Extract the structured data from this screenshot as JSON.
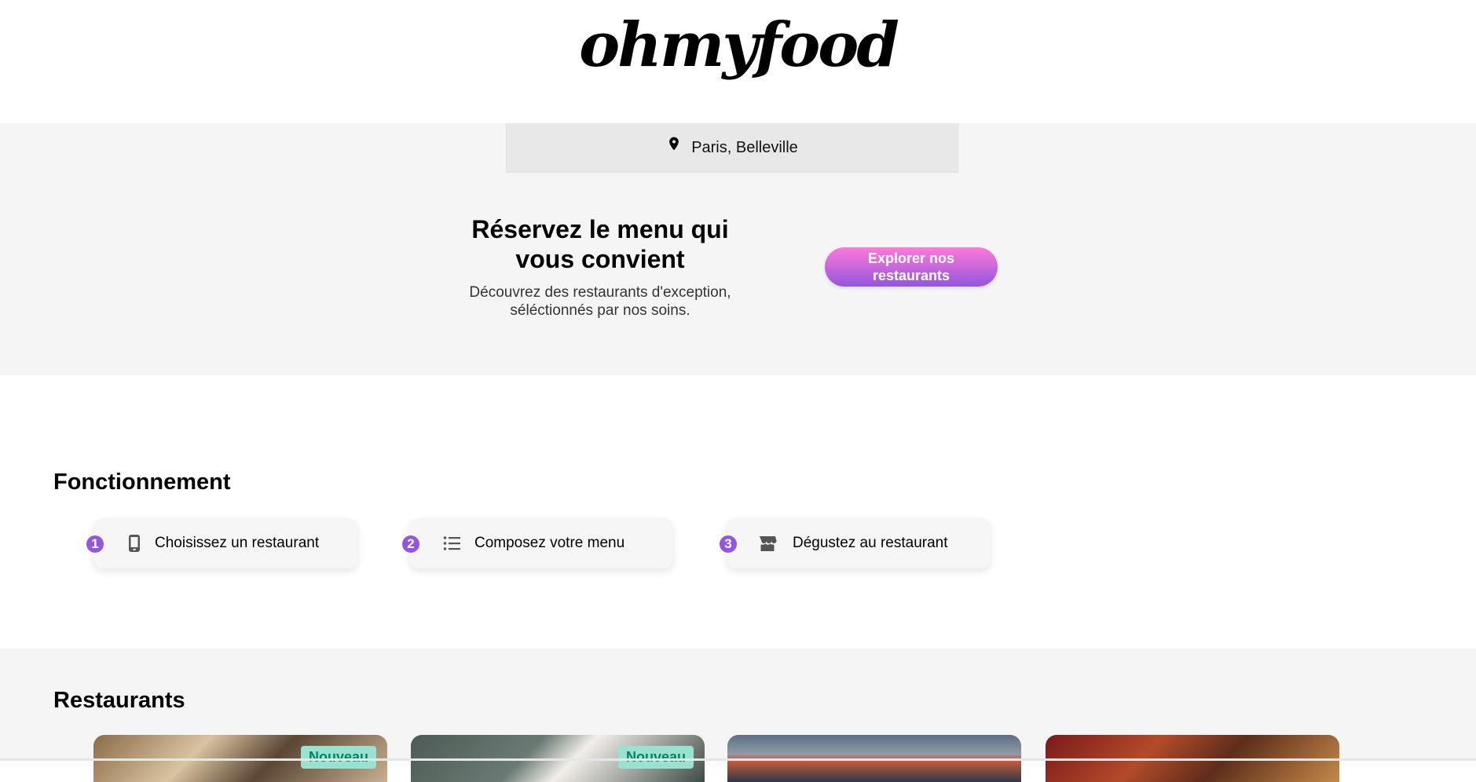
{
  "header": {
    "logo": "ohmyfood"
  },
  "hero": {
    "location": "Paris, Belleville",
    "title": "Réservez le menu qui vous convient",
    "subtitle": "Découvrez des restaurants d'exception, séléctionnés par nos soins.",
    "cta_label": "Explorer nos restaurants"
  },
  "how_it_works": {
    "title": "Fonctionnement",
    "steps": [
      {
        "number": "1",
        "icon": "smartphone-icon",
        "label": "Choisissez un restaurant"
      },
      {
        "number": "2",
        "icon": "list-icon",
        "label": "Composez votre menu"
      },
      {
        "number": "3",
        "icon": "store-icon",
        "label": "Dégustez au restaurant"
      }
    ]
  },
  "restaurants": {
    "title": "Restaurants",
    "cards": [
      {
        "badge": "Nouveau"
      },
      {
        "badge": "Nouveau"
      },
      {
        "badge": ""
      },
      {
        "badge": ""
      }
    ]
  },
  "colors": {
    "accent_purple": "#9356dc",
    "accent_pink": "#ff79da",
    "badge_bg": "#99e2d0",
    "badge_text": "#00836a",
    "section_bg": "#f5f5f5"
  }
}
